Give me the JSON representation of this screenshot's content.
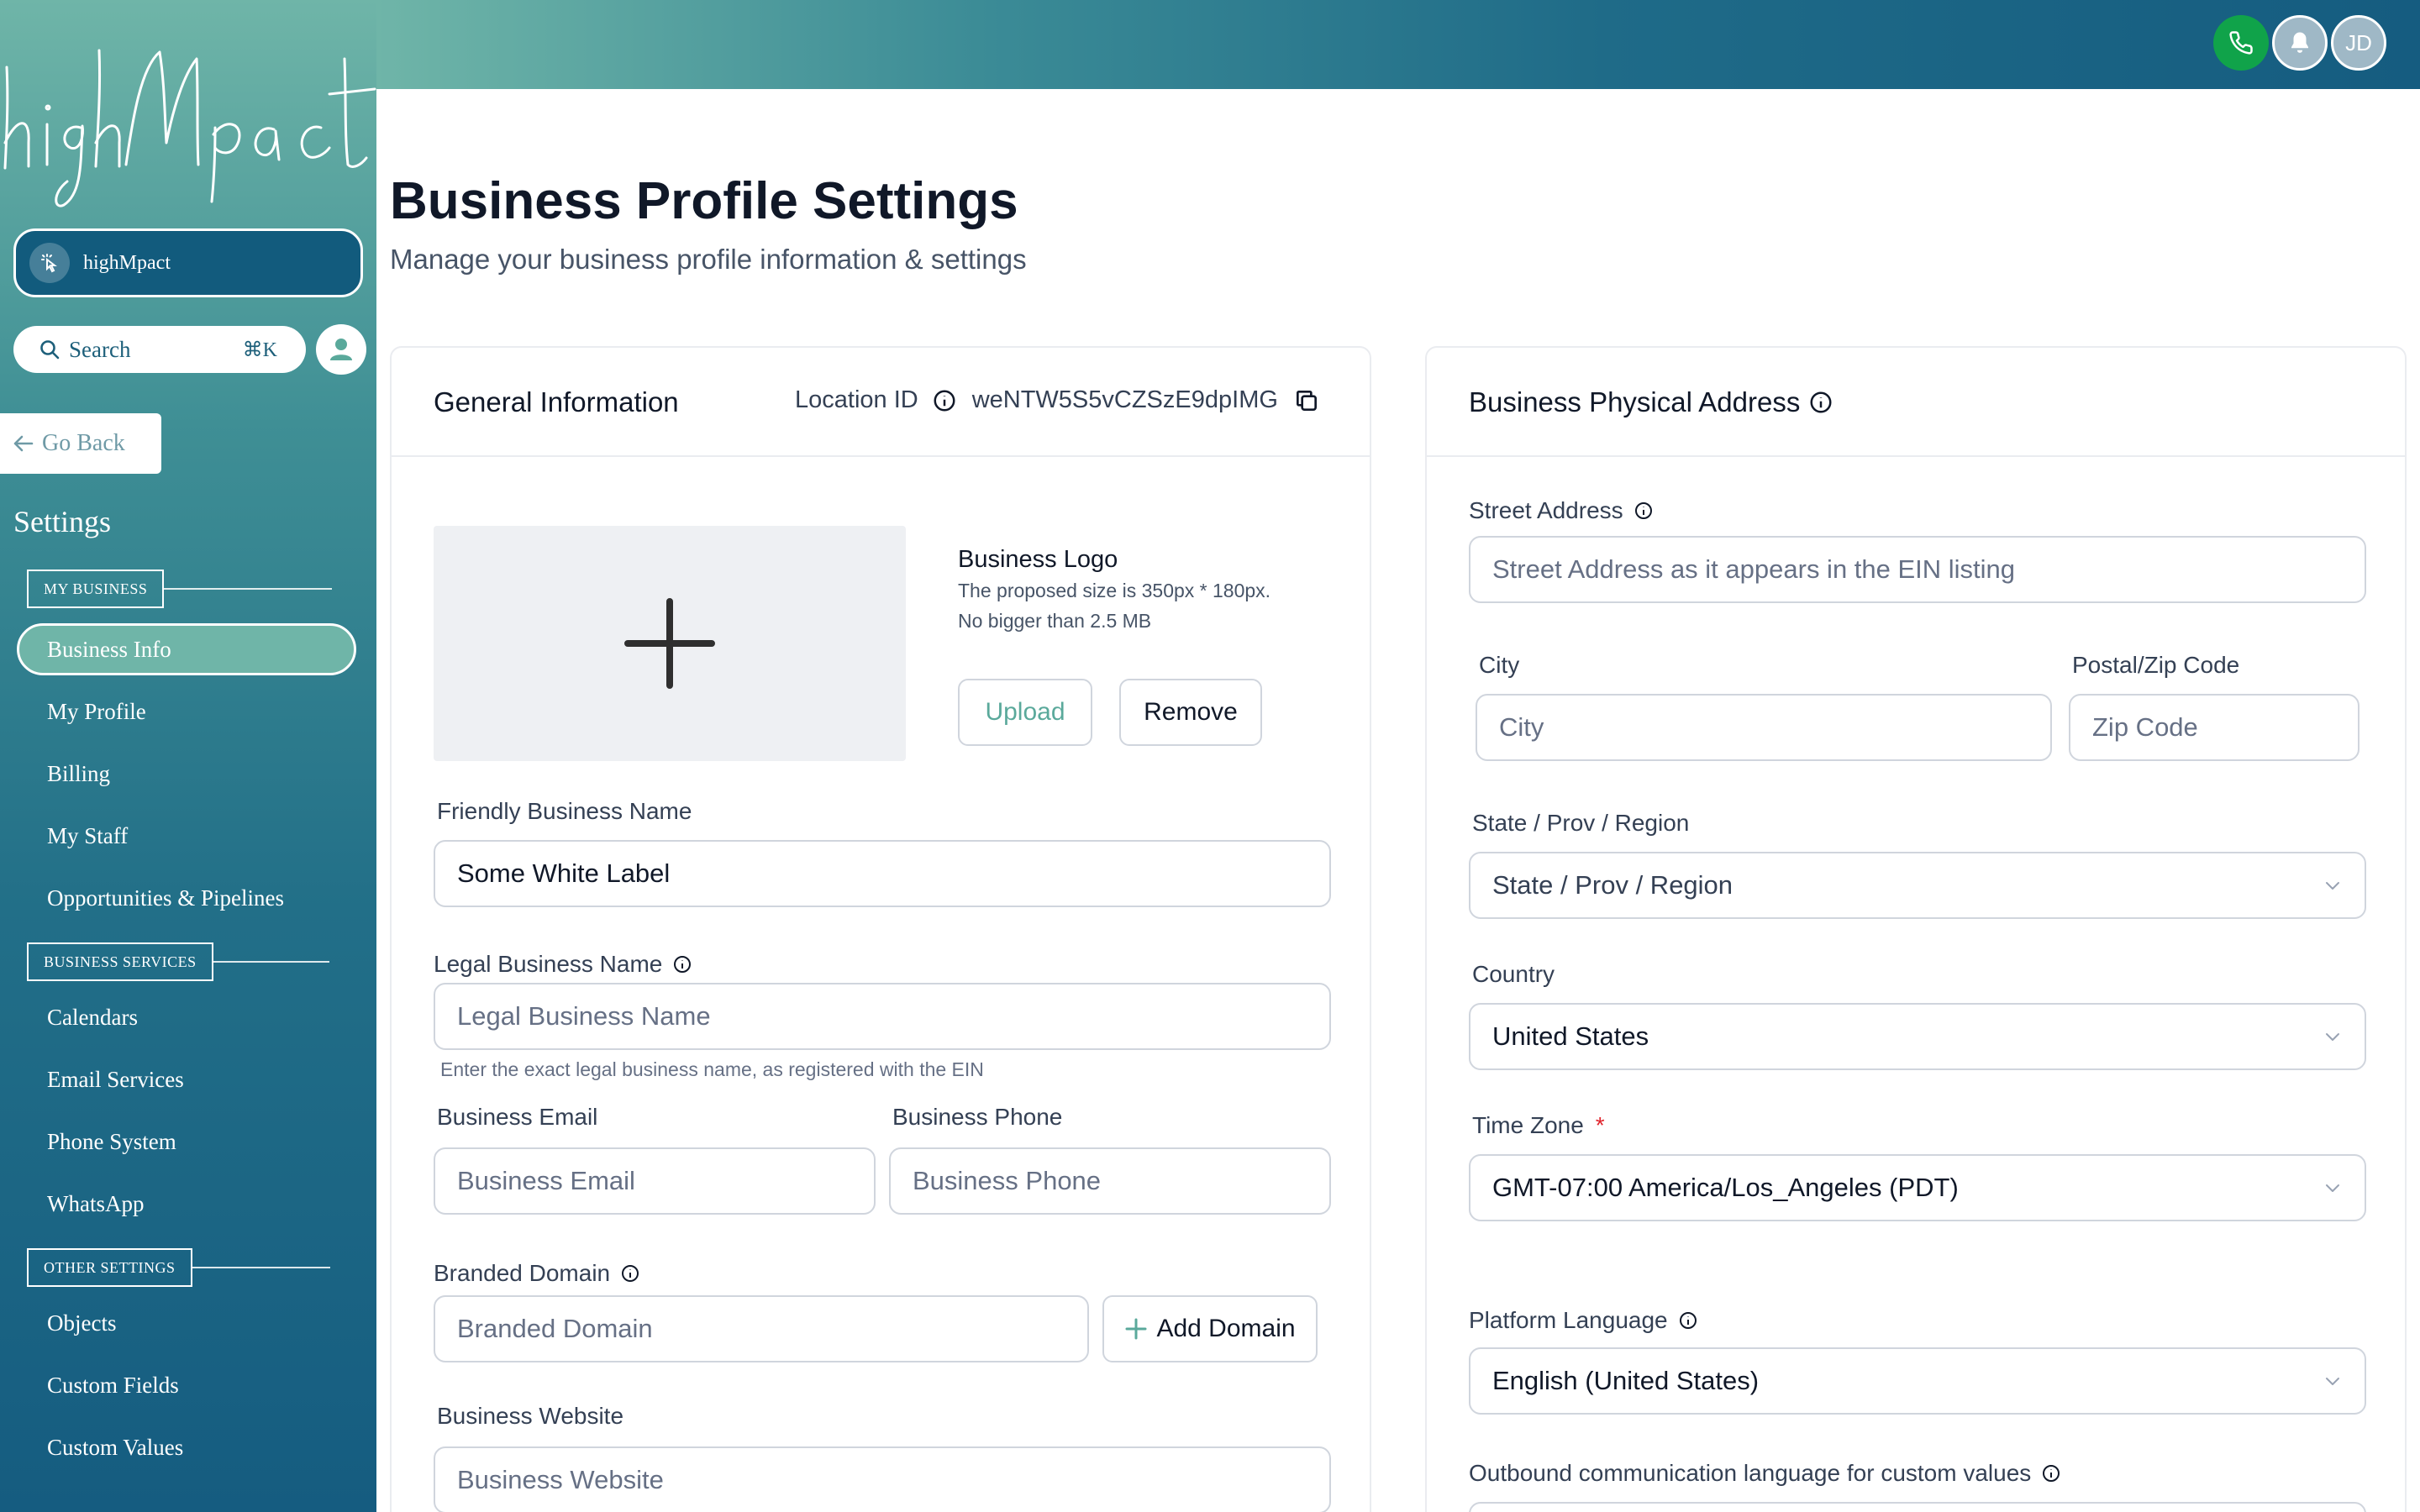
{
  "sidebar": {
    "logo_text": "highMpact",
    "location_name": "highMpact",
    "search_label": "Search",
    "search_shortcut": "⌘K",
    "go_back": "Go Back",
    "settings_title": "Settings",
    "sections": [
      {
        "label": "MY BUSINESS",
        "items": [
          "Business Info",
          "My Profile",
          "Billing",
          "My Staff",
          "Opportunities & Pipelines"
        ]
      },
      {
        "label": "BUSINESS SERVICES",
        "items": [
          "Calendars",
          "Email Services",
          "Phone System",
          "WhatsApp"
        ]
      },
      {
        "label": "OTHER SETTINGS",
        "items": [
          "Objects",
          "Custom Fields",
          "Custom Values"
        ]
      }
    ],
    "active_item": "Business Info"
  },
  "header": {
    "avatar_initials": "JD",
    "phone_icon": "phone-icon",
    "bell_icon": "bell-icon"
  },
  "page": {
    "title": "Business Profile Settings",
    "subtitle": "Manage your business profile information & settings"
  },
  "general": {
    "title": "General Information",
    "location_id_label": "Location ID",
    "location_id_value": "weNTW5S5vCZSzE9dpIMG",
    "logo_label": "Business Logo",
    "logo_hint_1": "The proposed size is 350px * 180px.",
    "logo_hint_2": "No bigger than 2.5 MB",
    "upload_label": "Upload",
    "remove_label": "Remove",
    "friendly_name_label": "Friendly Business Name",
    "friendly_name_value": "Some White Label",
    "legal_name_label": "Legal Business Name",
    "legal_name_placeholder": "Legal Business Name",
    "legal_name_hint": "Enter the exact legal business name, as registered with the EIN",
    "email_label": "Business Email",
    "email_placeholder": "Business Email",
    "phone_label": "Business Phone",
    "phone_placeholder": "Business Phone",
    "domain_label": "Branded Domain",
    "domain_placeholder": "Branded Domain",
    "add_domain_label": "Add Domain",
    "website_label": "Business Website",
    "website_placeholder": "Business Website"
  },
  "address": {
    "title": "Business Physical Address",
    "street_label": "Street Address",
    "street_placeholder": "Street Address as it appears in the EIN listing",
    "city_label": "City",
    "city_placeholder": "City",
    "zip_label": "Postal/Zip Code",
    "zip_placeholder": "Zip Code",
    "state_label": "State / Prov / Region",
    "state_placeholder": "State / Prov / Region",
    "country_label": "Country",
    "country_value": "United States",
    "timezone_label": "Time Zone",
    "timezone_required": "*",
    "timezone_value": "GMT-07:00 America/Los_Angeles (PDT)",
    "language_label": "Platform Language",
    "language_value": "English (United States)",
    "outbound_label": "Outbound communication language for custom values"
  },
  "colors": {
    "sidebar_top": "#6fb5a8",
    "sidebar_bottom": "#155c80",
    "phone_green": "#10a34a",
    "accent_teal": "#5aa99b",
    "required_red": "#e0242c"
  }
}
